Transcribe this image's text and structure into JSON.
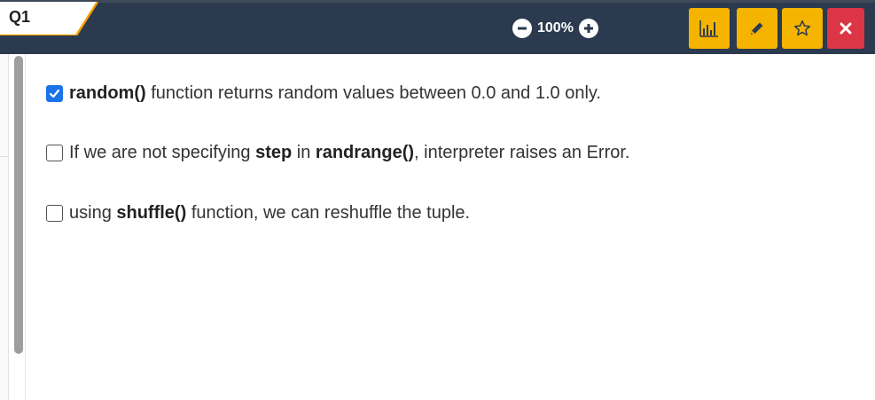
{
  "colors": {
    "topbar": "#2b3a4f",
    "accent_yellow": "#f5b400",
    "close_red": "#dc3545",
    "checkbox_blue": "#1a73e8"
  },
  "tab": {
    "label": "Q1"
  },
  "zoom": {
    "value": "100%"
  },
  "toolbar": {
    "icons": [
      "bar-chart-icon",
      "pencil-icon",
      "star-icon",
      "close-icon"
    ]
  },
  "options": [
    {
      "checked": true,
      "parts": [
        "random()",
        " function returns random values between 0.0 and 1.0 only."
      ]
    },
    {
      "checked": false,
      "parts": [
        "If we are not specifying ",
        "step",
        " in ",
        "randrange()",
        ", interpreter raises an Error."
      ]
    },
    {
      "checked": false,
      "parts": [
        "using ",
        "shuffle()",
        " function, we can reshuffle the tuple."
      ]
    }
  ]
}
